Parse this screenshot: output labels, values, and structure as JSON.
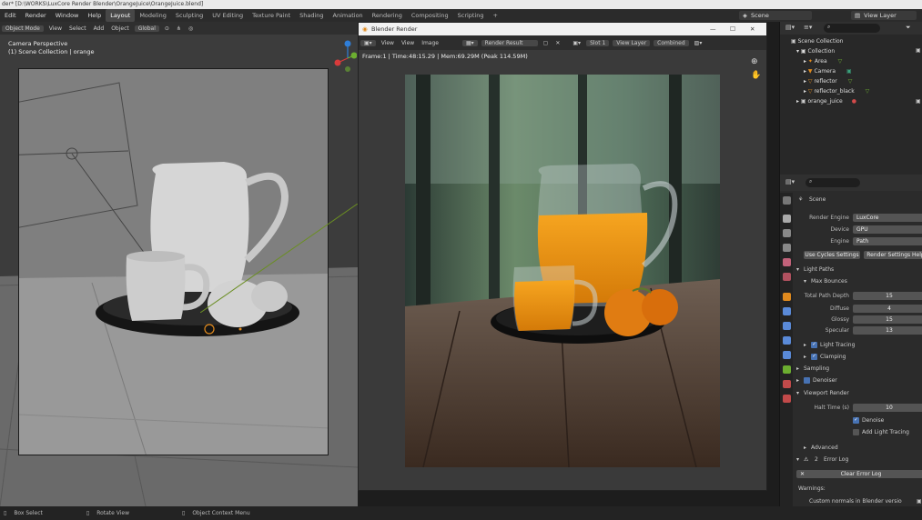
{
  "window": {
    "title": "der* [D:\\WORKS\\LuxCore Render Blender\\OrangeJuice\\OrangeJuice.blend]"
  },
  "menu": [
    "Edit",
    "Render",
    "Window",
    "Help"
  ],
  "workspaces": [
    "Layout",
    "Modeling",
    "Sculpting",
    "UV Editing",
    "Texture Paint",
    "Shading",
    "Animation",
    "Rendering",
    "Compositing",
    "Scripting"
  ],
  "topright": {
    "scene": "Scene",
    "view_layer": "View Layer"
  },
  "viewport": {
    "mode": "Object Mode",
    "menu": [
      "View",
      "Select",
      "Add",
      "Object"
    ],
    "orientation": "Global",
    "info_line1": "Camera Perspective",
    "info_line2": "(1) Scene Collection | orange"
  },
  "render_window": {
    "title": "Blender Render",
    "menu": [
      "View",
      "View",
      "Image"
    ],
    "image_name": "Render Result",
    "slot": "Slot 1",
    "layer": "View Layer",
    "pass": "Combined",
    "info": "Frame:1 | Time:48:15.29 | Mem:69.29M (Peak 114.59M)"
  },
  "outliner": {
    "items": [
      {
        "label": "Scene Collection",
        "level": 0
      },
      {
        "label": "Collection",
        "level": 1
      },
      {
        "label": "Area",
        "level": 2
      },
      {
        "label": "Camera",
        "level": 2
      },
      {
        "label": "reflector",
        "level": 2
      },
      {
        "label": "reflector_black",
        "level": 2
      },
      {
        "label": "orange_juice",
        "level": 1
      }
    ]
  },
  "properties": {
    "scene_label": "Scene",
    "render_engine_label": "Render Engine",
    "render_engine": "LuxCore",
    "device_label": "Device",
    "device": "GPU",
    "engine_label": "Engine",
    "engine": "Path",
    "use_cycles_btn": "Use Cycles Settings",
    "render_settings_btn": "Render Settings Help",
    "light_paths": "Light Paths",
    "max_bounces": "Max Bounces",
    "total_depth_label": "Total Path Depth",
    "total_depth": "15",
    "diffuse_label": "Diffuse",
    "diffuse": "4",
    "glossy_label": "Glossy",
    "glossy": "15",
    "specular_label": "Specular",
    "specular": "13",
    "light_tracing": "Light Tracing",
    "clamping": "Clamping",
    "sampling": "Sampling",
    "denoiser": "Denoiser",
    "viewport_render": "Viewport Render",
    "halt_time_label": "Halt Time (s)",
    "halt_time": "10",
    "denoise": "Denoise",
    "add_light_tracing": "Add Light Tracing",
    "advanced": "Advanced",
    "error_count": "2",
    "error_log": "Error Log",
    "clear_error_log": "Clear Error Log",
    "warnings": "Warnings:",
    "warning_text": "Custom normals in Blender versio"
  },
  "status": {
    "select": "Box Select",
    "rotate": "Rotate View",
    "context": "Object Context Menu"
  },
  "colors": {
    "accent": "#4772b3",
    "active_tab": "#474747",
    "orange": "#e08a1e"
  }
}
